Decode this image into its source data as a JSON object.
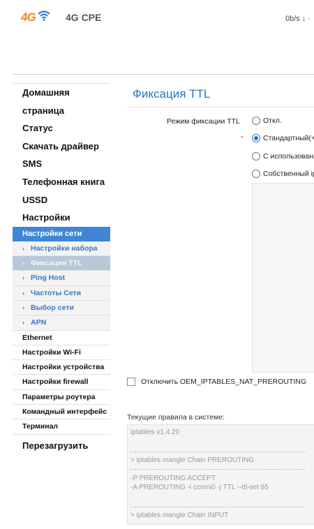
{
  "header": {
    "logo_text": "4G",
    "product": "4G CPE",
    "speed": "0b/s ↓ ·",
    "brand_color": "#f08a1c",
    "wifi_icon": "wifi-icon"
  },
  "sidebar": {
    "main_items": [
      "Домашняя",
      "страница",
      "Статус",
      "Скачать драйвер",
      "SMS",
      "Телефонная книга",
      "USSD",
      "Настройки"
    ],
    "section_title": "Настройки сети",
    "sub_items": [
      "Настройки набора",
      "Фиксация TTL",
      "Ping Host",
      "Частоты Сети",
      "Выбор сети",
      "APN"
    ],
    "active_sub": "Фиксация TTL",
    "other_items": [
      "Ethernet",
      "Настройки Wi-Fi",
      "Настройки устройства",
      "Настройки firewall",
      "Параметры роутера",
      "Командный интерфейс",
      "Терминал"
    ],
    "reboot": "Перезагрузить",
    "accent_color": "#3f87d6"
  },
  "content": {
    "title": "Фиксация TTL",
    "mode_label": "Режим фиксации TTL",
    "required_mark": "*",
    "options": [
      "Откл.",
      "Стандартный(+",
      "С использовани",
      "Собственный ip"
    ],
    "selected_option": "Стандартный(+",
    "checkbox_label": "Отключить OEM_IPTABLES_NAT_PREROUTING",
    "rules_label": "Текущие правила в системе:",
    "rules_lines": [
      "iptables v1.4.20",
      "> iptables mangle Chain PREROUTING",
      "-P PREROUTING ACCEPT",
      "-A PREROUTING -i ccmni0 -j TTL --ttl-set 65",
      "> iptables mangle Chain INPUT"
    ]
  }
}
